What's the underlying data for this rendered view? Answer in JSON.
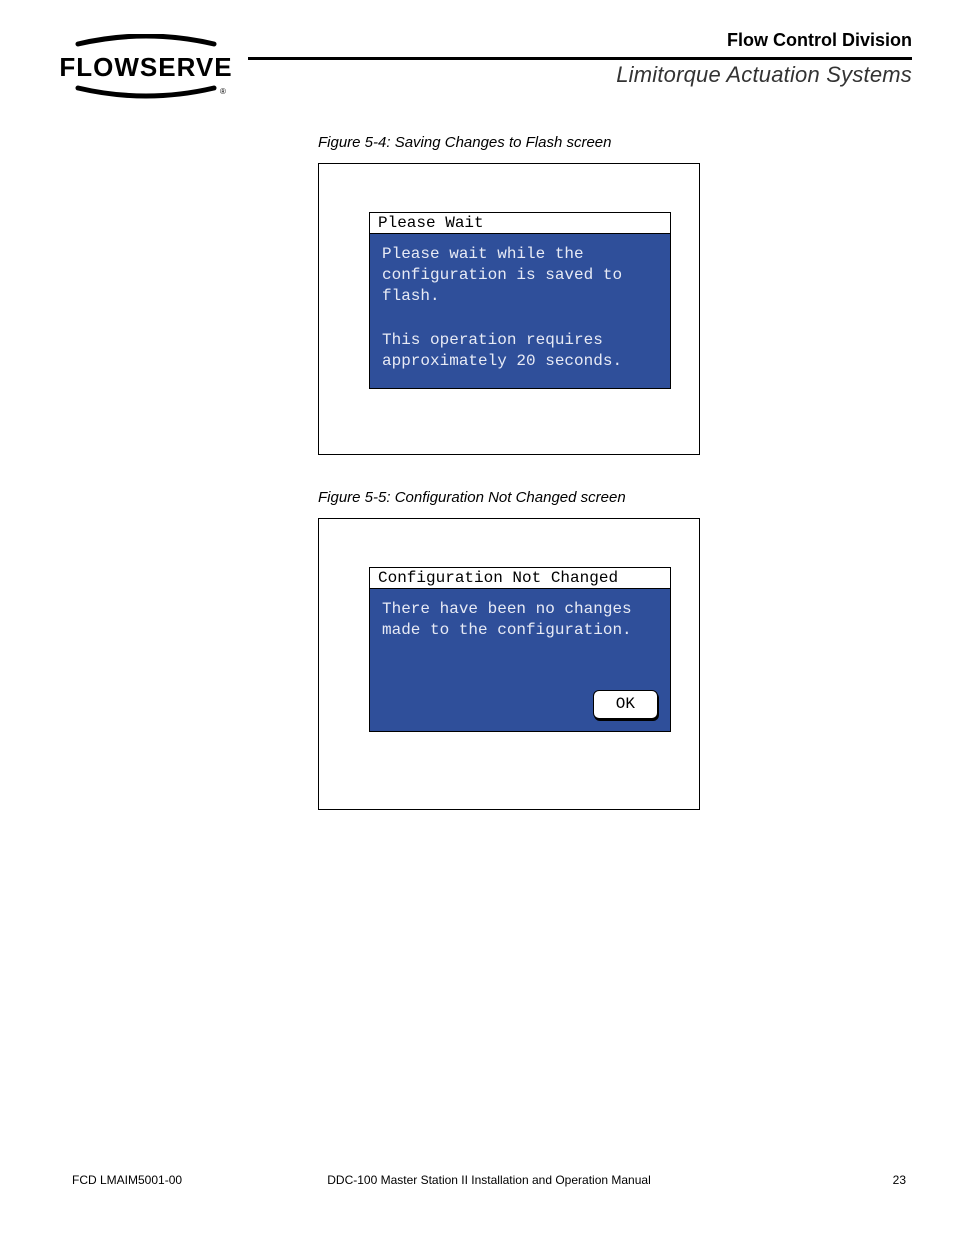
{
  "header": {
    "division": "Flow Control Division",
    "subsystem": "Limitorque Actuation Systems",
    "logo_text": "FLOWSERVE"
  },
  "figures": {
    "f1": {
      "caption": "Figure 5-4: Saving Changes to Flash screen",
      "dialog_title": "Please Wait",
      "line1": "Please wait while the configuration is saved to flash.",
      "line2": "This operation requires approximately 20 seconds."
    },
    "f2": {
      "caption": "Figure 5-5: Configuration Not Changed screen",
      "dialog_title": "Configuration Not Changed",
      "line1": "There have been no changes made to the configuration.",
      "ok_label": "OK"
    }
  },
  "footer": {
    "left": "FCD LMAIM5001-00",
    "center": "DDC-100 Master Station II Installation and Operation Manual",
    "right": "23"
  }
}
